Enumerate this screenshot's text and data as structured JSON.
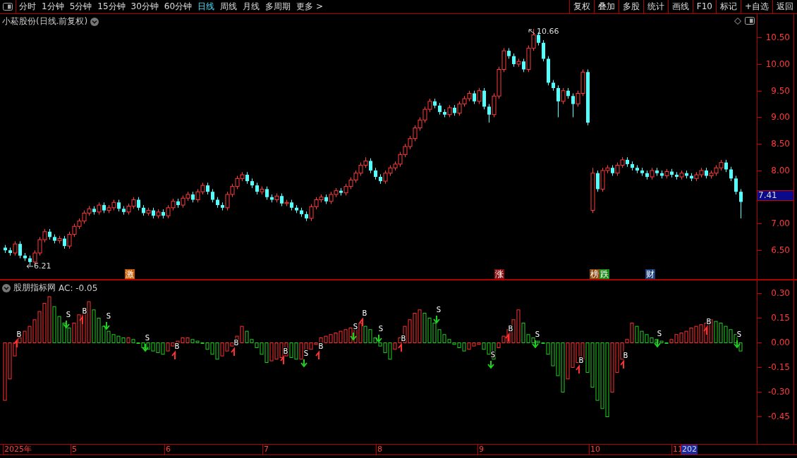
{
  "toolbar": {
    "periods": [
      {
        "label": "分时",
        "selected": false
      },
      {
        "label": "1分钟",
        "selected": false
      },
      {
        "label": "5分钟",
        "selected": false
      },
      {
        "label": "15分钟",
        "selected": false
      },
      {
        "label": "30分钟",
        "selected": false
      },
      {
        "label": "60分钟",
        "selected": false
      },
      {
        "label": "日线",
        "selected": true
      },
      {
        "label": "周线",
        "selected": false
      },
      {
        "label": "月线",
        "selected": false
      },
      {
        "label": "多周期",
        "selected": false
      },
      {
        "label": "更多 >",
        "selected": false
      }
    ],
    "actions": [
      "复权",
      "叠加",
      "多股",
      "统计",
      "画线",
      "F10",
      "标记",
      "+自选",
      "返回"
    ]
  },
  "main_chart": {
    "title": "小菘股份(日线.前复权)",
    "high_label": "10.66",
    "low_label": "6.21",
    "current_price": "7.41",
    "tags": [
      {
        "label": "激",
        "color": "#c85a00"
      },
      {
        "label": "涨",
        "color": "#8a1010"
      },
      {
        "label": "榜",
        "color": "#8a4a10"
      },
      {
        "label": "跌",
        "color": "#1a8a1a"
      },
      {
        "label": "财",
        "color": "#1a3f7a"
      }
    ],
    "chart_data": {
      "type": "candlestick",
      "ylim": [
        5.96,
        10.94
      ],
      "categories": [
        null,
        null,
        null,
        null,
        null,
        null,
        null,
        null,
        null,
        null,
        null,
        null,
        null,
        null,
        null,
        null,
        null,
        null,
        null,
        null,
        null,
        null,
        null,
        null,
        null,
        null,
        null,
        null,
        null,
        null,
        null,
        null,
        null,
        null,
        null,
        null,
        null,
        null,
        null,
        null,
        null,
        null,
        null,
        null,
        null,
        null,
        null,
        null,
        null,
        null,
        null,
        null,
        null,
        null,
        null,
        null,
        null,
        null,
        null,
        null,
        null,
        null,
        null,
        null,
        null,
        null,
        null,
        null,
        null,
        null,
        null,
        null,
        null,
        null,
        null,
        null,
        null,
        null,
        null,
        null,
        null,
        null,
        null,
        null,
        null,
        null,
        null,
        null,
        null,
        null,
        null,
        null,
        null,
        null,
        null,
        null,
        null,
        null,
        null,
        null,
        null,
        null,
        null,
        null,
        null,
        null,
        null,
        null,
        null,
        null,
        null,
        null,
        null,
        null,
        null,
        null,
        null,
        null,
        null,
        null,
        null,
        null,
        null,
        null,
        null,
        null,
        null,
        null,
        null,
        null,
        null,
        null,
        null,
        null,
        null,
        null,
        null,
        null,
        null,
        null,
        null,
        null,
        null,
        null,
        null,
        null,
        null,
        null,
        null,
        null
      ],
      "yticks": [
        {
          "value": 10.5,
          "label": "10.50"
        },
        {
          "value": 10,
          "label": "10.00"
        },
        {
          "value": 9.5,
          "label": "9.50"
        },
        {
          "value": 9,
          "label": "9.00"
        },
        {
          "value": 8.5,
          "label": "8.50"
        },
        {
          "value": 8,
          "label": "8.00"
        },
        {
          "value": 7,
          "label": "7.00"
        },
        {
          "value": 6.5,
          "label": "6.50"
        }
      ],
      "ohlc": [
        [
          6.55,
          6.6,
          6.45,
          6.5
        ],
        [
          6.5,
          6.55,
          6.4,
          6.45
        ],
        [
          6.45,
          6.67,
          6.4,
          6.62
        ],
        [
          6.62,
          6.67,
          6.35,
          6.4
        ],
        [
          6.4,
          6.45,
          6.3,
          6.35
        ],
        [
          6.35,
          6.4,
          6.21,
          6.28
        ],
        [
          6.28,
          6.5,
          6.23,
          6.45
        ],
        [
          6.45,
          6.75,
          6.4,
          6.7
        ],
        [
          6.7,
          6.9,
          6.65,
          6.85
        ],
        [
          6.85,
          6.9,
          6.7,
          6.75
        ],
        [
          6.75,
          6.8,
          6.63,
          6.68
        ],
        [
          6.68,
          6.77,
          6.63,
          6.72
        ],
        [
          6.72,
          6.77,
          6.53,
          6.58
        ],
        [
          6.58,
          6.85,
          6.53,
          6.8
        ],
        [
          6.8,
          7.0,
          6.75,
          6.95
        ],
        [
          6.95,
          7.1,
          6.9,
          7.05
        ],
        [
          7.05,
          7.25,
          7.0,
          7.2
        ],
        [
          7.2,
          7.33,
          7.15,
          7.28
        ],
        [
          7.28,
          7.33,
          7.17,
          7.22
        ],
        [
          7.22,
          7.4,
          7.17,
          7.35
        ],
        [
          7.35,
          7.4,
          7.2,
          7.25
        ],
        [
          7.25,
          7.35,
          7.2,
          7.3
        ],
        [
          7.3,
          7.45,
          7.25,
          7.4
        ],
        [
          7.4,
          7.45,
          7.23,
          7.28
        ],
        [
          7.28,
          7.33,
          7.17,
          7.22
        ],
        [
          7.22,
          7.38,
          7.17,
          7.33
        ],
        [
          7.33,
          7.5,
          7.28,
          7.45
        ],
        [
          7.45,
          7.5,
          7.25,
          7.3
        ],
        [
          7.3,
          7.35,
          7.15,
          7.2
        ],
        [
          7.2,
          7.3,
          7.15,
          7.25
        ],
        [
          7.25,
          7.3,
          7.1,
          7.15
        ],
        [
          7.15,
          7.27,
          7.1,
          7.22
        ],
        [
          7.22,
          7.27,
          7.1,
          7.15
        ],
        [
          7.15,
          7.35,
          7.1,
          7.3
        ],
        [
          7.3,
          7.47,
          7.25,
          7.42
        ],
        [
          7.42,
          7.47,
          7.3,
          7.35
        ],
        [
          7.35,
          7.53,
          7.3,
          7.48
        ],
        [
          7.48,
          7.6,
          7.43,
          7.55
        ],
        [
          7.55,
          7.6,
          7.4,
          7.45
        ],
        [
          7.45,
          7.65,
          7.4,
          7.6
        ],
        [
          7.6,
          7.77,
          7.55,
          7.72
        ],
        [
          7.72,
          7.77,
          7.55,
          7.6
        ],
        [
          7.6,
          7.65,
          7.4,
          7.45
        ],
        [
          7.45,
          7.5,
          7.3,
          7.35
        ],
        [
          7.35,
          7.4,
          7.25,
          7.3
        ],
        [
          7.3,
          7.6,
          7.25,
          7.55
        ],
        [
          7.55,
          7.75,
          7.5,
          7.7
        ],
        [
          7.7,
          7.9,
          7.65,
          7.85
        ],
        [
          7.85,
          7.97,
          7.8,
          7.92
        ],
        [
          7.92,
          7.97,
          7.75,
          7.8
        ],
        [
          7.8,
          7.85,
          7.67,
          7.72
        ],
        [
          7.72,
          7.77,
          7.55,
          7.6
        ],
        [
          7.6,
          7.7,
          7.55,
          7.65
        ],
        [
          7.65,
          7.7,
          7.45,
          7.5
        ],
        [
          7.5,
          7.55,
          7.4,
          7.45
        ],
        [
          7.45,
          7.57,
          7.4,
          7.52
        ],
        [
          7.52,
          7.57,
          7.33,
          7.38
        ],
        [
          7.38,
          7.45,
          7.33,
          7.4
        ],
        [
          7.4,
          7.45,
          7.25,
          7.3
        ],
        [
          7.3,
          7.35,
          7.2,
          7.25
        ],
        [
          7.25,
          7.3,
          7.13,
          7.18
        ],
        [
          7.18,
          7.23,
          7.05,
          7.1
        ],
        [
          7.1,
          7.37,
          7.05,
          7.32
        ],
        [
          7.32,
          7.5,
          7.27,
          7.45
        ],
        [
          7.45,
          7.55,
          7.4,
          7.5
        ],
        [
          7.5,
          7.55,
          7.37,
          7.42
        ],
        [
          7.42,
          7.6,
          7.37,
          7.55
        ],
        [
          7.55,
          7.67,
          7.5,
          7.62
        ],
        [
          7.62,
          7.67,
          7.53,
          7.58
        ],
        [
          7.58,
          7.75,
          7.53,
          7.7
        ],
        [
          7.7,
          7.87,
          7.65,
          7.82
        ],
        [
          7.82,
          8.0,
          7.77,
          7.95
        ],
        [
          7.95,
          8.15,
          7.9,
          8.1
        ],
        [
          8.1,
          8.25,
          8.05,
          8.18
        ],
        [
          8.18,
          8.23,
          7.95,
          8.0
        ],
        [
          8.0,
          8.05,
          7.83,
          7.88
        ],
        [
          7.88,
          7.93,
          7.75,
          7.8
        ],
        [
          7.8,
          8.0,
          7.75,
          7.95
        ],
        [
          7.95,
          8.1,
          7.9,
          8.05
        ],
        [
          8.05,
          8.17,
          8.0,
          8.12
        ],
        [
          8.12,
          8.35,
          8.07,
          8.3
        ],
        [
          8.3,
          8.5,
          8.25,
          8.45
        ],
        [
          8.45,
          8.65,
          8.4,
          8.6
        ],
        [
          8.6,
          8.85,
          8.55,
          8.8
        ],
        [
          8.8,
          9.0,
          8.75,
          8.95
        ],
        [
          8.95,
          9.2,
          8.9,
          9.15
        ],
        [
          9.15,
          9.35,
          9.1,
          9.3
        ],
        [
          9.3,
          9.35,
          9.17,
          9.22
        ],
        [
          9.22,
          9.27,
          9.05,
          9.1
        ],
        [
          9.1,
          9.15,
          9.0,
          9.05
        ],
        [
          9.05,
          9.23,
          9.0,
          9.18
        ],
        [
          9.18,
          9.23,
          9.03,
          9.08
        ],
        [
          9.08,
          9.3,
          9.03,
          9.25
        ],
        [
          9.25,
          9.4,
          9.2,
          9.35
        ],
        [
          9.35,
          9.5,
          9.3,
          9.45
        ],
        [
          9.45,
          9.5,
          9.25,
          9.3
        ],
        [
          9.3,
          9.55,
          9.25,
          9.5
        ],
        [
          9.5,
          9.55,
          9.15,
          9.2
        ],
        [
          9.2,
          9.25,
          8.9,
          9.05
        ],
        [
          9.05,
          9.45,
          9.0,
          9.4
        ],
        [
          9.4,
          9.95,
          9.35,
          9.9
        ],
        [
          9.9,
          10.3,
          9.85,
          10.25
        ],
        [
          10.25,
          10.3,
          10.1,
          10.15
        ],
        [
          10.15,
          10.2,
          9.95,
          10.0
        ],
        [
          10.0,
          10.1,
          9.95,
          10.05
        ],
        [
          10.05,
          10.1,
          9.85,
          9.9
        ],
        [
          9.9,
          10.35,
          9.85,
          10.3
        ],
        [
          10.3,
          10.66,
          10.25,
          10.55
        ],
        [
          10.55,
          10.6,
          10.35,
          10.4
        ],
        [
          10.4,
          10.45,
          10.05,
          10.1
        ],
        [
          10.1,
          10.15,
          9.6,
          9.65
        ],
        [
          9.65,
          9.7,
          9.5,
          9.55
        ],
        [
          9.55,
          9.6,
          9.0,
          9.3
        ],
        [
          9.3,
          9.55,
          9.25,
          9.5
        ],
        [
          9.5,
          9.55,
          9.35,
          9.4
        ],
        [
          9.4,
          9.45,
          9.0,
          9.25
        ],
        [
          9.25,
          9.5,
          9.2,
          9.45
        ],
        [
          9.45,
          9.9,
          9.4,
          9.85
        ],
        [
          9.85,
          9.9,
          8.85,
          8.9
        ],
        [
          7.25,
          8.05,
          7.2,
          7.95
        ],
        [
          7.95,
          8.0,
          7.6,
          7.65
        ],
        [
          7.65,
          8.05,
          7.6,
          8.0
        ],
        [
          8.0,
          8.1,
          7.95,
          8.05
        ],
        [
          8.05,
          8.1,
          7.9,
          7.95
        ],
        [
          7.95,
          8.15,
          7.9,
          8.1
        ],
        [
          8.1,
          8.25,
          8.05,
          8.2
        ],
        [
          8.2,
          8.25,
          8.07,
          8.12
        ],
        [
          8.12,
          8.17,
          8.0,
          8.05
        ],
        [
          8.05,
          8.1,
          7.95,
          8.0
        ],
        [
          8.0,
          8.05,
          7.9,
          7.95
        ],
        [
          7.95,
          8.0,
          7.83,
          7.88
        ],
        [
          7.88,
          8.05,
          7.83,
          8.0
        ],
        [
          8.0,
          8.05,
          7.9,
          7.95
        ],
        [
          7.95,
          8.0,
          7.85,
          7.9
        ],
        [
          7.9,
          8.03,
          7.85,
          7.98
        ],
        [
          7.98,
          8.03,
          7.87,
          7.92
        ],
        [
          7.92,
          7.97,
          7.83,
          7.88
        ],
        [
          7.88,
          8.0,
          7.83,
          7.95
        ],
        [
          7.95,
          8.0,
          7.85,
          7.9
        ],
        [
          7.9,
          7.95,
          7.8,
          7.85
        ],
        [
          7.85,
          7.97,
          7.8,
          7.92
        ],
        [
          7.92,
          8.05,
          7.87,
          8.0
        ],
        [
          8.0,
          8.05,
          7.85,
          7.9
        ],
        [
          7.9,
          8.0,
          7.85,
          7.95
        ],
        [
          7.95,
          8.1,
          7.9,
          8.05
        ],
        [
          8.05,
          8.2,
          8.0,
          8.15
        ],
        [
          8.15,
          8.2,
          7.97,
          8.02
        ],
        [
          8.02,
          8.07,
          7.8,
          7.85
        ],
        [
          7.85,
          7.9,
          7.55,
          7.6
        ],
        [
          7.6,
          7.65,
          7.1,
          7.41
        ]
      ]
    }
  },
  "indicator": {
    "title": "股朋指标网",
    "reading": "AC: -0.05",
    "chart_data": {
      "type": "bar",
      "ylim": [
        -0.615,
        0.379
      ],
      "categories": [
        null,
        null,
        null,
        null,
        null,
        null,
        null,
        null,
        null,
        null,
        null,
        null,
        null,
        null,
        null,
        null,
        null,
        null,
        null,
        null,
        null,
        null,
        null,
        null,
        null,
        null,
        null,
        null,
        null,
        null,
        null,
        null,
        null,
        null,
        null,
        null,
        null,
        null,
        null,
        null,
        null,
        null,
        null,
        null,
        null,
        null,
        null,
        null,
        null,
        null,
        null,
        null,
        null,
        null,
        null,
        null,
        null,
        null,
        null,
        null,
        null,
        null,
        null,
        null,
        null,
        null,
        null,
        null,
        null,
        null,
        null,
        null,
        null,
        null,
        null,
        null,
        null,
        null,
        null,
        null,
        null,
        null,
        null,
        null,
        null,
        null,
        null,
        null,
        null,
        null,
        null,
        null,
        null,
        null,
        null,
        null,
        null,
        null,
        null,
        null,
        null,
        null,
        null,
        null,
        null,
        null,
        null,
        null,
        null,
        null,
        null,
        null,
        null,
        null,
        null,
        null,
        null,
        null,
        null,
        null,
        null,
        null,
        null,
        null,
        null,
        null,
        null,
        null,
        null,
        null,
        null,
        null,
        null,
        null,
        null,
        null,
        null,
        null,
        null,
        null,
        null,
        null,
        null,
        null,
        null,
        null,
        null,
        null,
        null,
        null
      ],
      "yticks": [
        {
          "value": 0.3,
          "label": "0.30"
        },
        {
          "value": 0.15,
          "label": "0.15"
        },
        {
          "value": 0,
          "label": "0.00"
        },
        {
          "value": -0.15,
          "label": "-0.15"
        },
        {
          "value": -0.3,
          "label": "-0.30"
        },
        {
          "value": -0.45,
          "label": "-0.45"
        }
      ],
      "values": [
        -0.35,
        -0.22,
        -0.08,
        0.03,
        0.07,
        0.1,
        0.14,
        0.19,
        0.24,
        0.28,
        0.22,
        0.16,
        0.12,
        0.09,
        0.12,
        0.17,
        0.21,
        0.25,
        0.2,
        0.15,
        0.1,
        0.07,
        0.05,
        0.04,
        0.03,
        0.03,
        0.02,
        0.0,
        -0.03,
        -0.04,
        -0.05,
        -0.06,
        -0.07,
        -0.05,
        -0.02,
        0.01,
        0.03,
        0.03,
        0.02,
        0.01,
        0.0,
        -0.04,
        -0.07,
        -0.1,
        -0.08,
        -0.05,
        -0.02,
        0.04,
        0.1,
        0.07,
        0.02,
        -0.03,
        -0.07,
        -0.12,
        -0.11,
        -0.1,
        -0.09,
        -0.08,
        -0.09,
        -0.1,
        -0.1,
        -0.07,
        -0.04,
        -0.01,
        0.03,
        0.04,
        0.05,
        0.06,
        0.07,
        0.08,
        0.09,
        0.11,
        0.12,
        0.1,
        0.08,
        0.03,
        -0.02,
        -0.06,
        -0.1,
        -0.04,
        0.03,
        0.1,
        0.14,
        0.18,
        0.2,
        0.18,
        0.15,
        0.12,
        0.08,
        0.05,
        0.02,
        -0.01,
        -0.03,
        -0.05,
        -0.04,
        -0.02,
        -0.01,
        -0.04,
        -0.07,
        -0.1,
        -0.03,
        0.04,
        0.08,
        0.14,
        0.2,
        0.12,
        0.05,
        0.03,
        0.01,
        0.0,
        -0.07,
        -0.14,
        -0.2,
        -0.3,
        -0.22,
        -0.15,
        -0.12,
        -0.1,
        -0.18,
        -0.27,
        -0.35,
        -0.4,
        -0.45,
        -0.3,
        -0.18,
        -0.1,
        0.02,
        0.12,
        0.1,
        0.07,
        0.05,
        0.03,
        0.02,
        0.01,
        0.0,
        0.02,
        0.05,
        0.06,
        0.07,
        0.09,
        0.1,
        0.11,
        0.12,
        0.14,
        0.13,
        0.12,
        0.1,
        0.08,
        0.05,
        -0.05
      ]
    },
    "signals": [
      {
        "label": "B",
        "kind": "buy"
      },
      {
        "label": "S",
        "kind": "sell"
      },
      {
        "label": "B",
        "kind": "buy"
      },
      {
        "label": "S",
        "kind": "sell"
      },
      {
        "label": "S",
        "kind": "sell"
      },
      {
        "label": "B",
        "kind": "buy"
      },
      {
        "label": "B",
        "kind": "buy"
      },
      {
        "label": "B",
        "kind": "buy"
      },
      {
        "label": "S",
        "kind": "sell"
      },
      {
        "label": "B",
        "kind": "buy"
      },
      {
        "label": "S",
        "kind": "sell"
      },
      {
        "label": "B",
        "kind": "buy"
      },
      {
        "label": "S",
        "kind": "sell"
      },
      {
        "label": "B",
        "kind": "buy"
      },
      {
        "label": "S",
        "kind": "sell"
      },
      {
        "label": "S",
        "kind": "sell"
      },
      {
        "label": "B",
        "kind": "buy"
      },
      {
        "label": "S",
        "kind": "sell"
      },
      {
        "label": "B",
        "kind": "buy"
      },
      {
        "label": "B",
        "kind": "buy"
      },
      {
        "label": "S",
        "kind": "sell"
      },
      {
        "label": "B",
        "kind": "buy"
      },
      {
        "label": "S",
        "kind": "sell"
      }
    ]
  },
  "date_axis": [
    {
      "label": "2025年",
      "selected": false
    },
    {
      "label": "5",
      "selected": false
    },
    {
      "label": "6",
      "selected": false
    },
    {
      "label": "7",
      "selected": false
    },
    {
      "label": "8",
      "selected": false
    },
    {
      "label": "9",
      "selected": false
    },
    {
      "label": "10",
      "selected": false
    },
    {
      "label": "11",
      "selected": false
    },
    {
      "label": "202",
      "selected": true
    }
  ]
}
